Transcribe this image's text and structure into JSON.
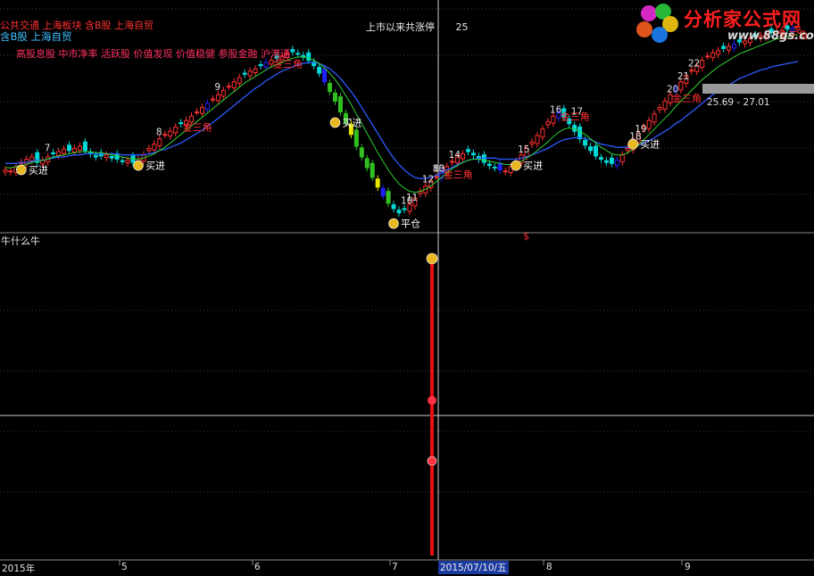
{
  "header": {
    "concept_line1": "公共交通 上海板块 含B股 上海自贸",
    "concept_line2": "含B股 上海自贸",
    "tags_line": "高股息股 中市净率 活跃股 价值发现 价值稳健 参股金融 沪港通",
    "since_listing_label": "上市以来共涨停",
    "since_listing_count": "25",
    "price_range": "25.69 - 27.01"
  },
  "logo": {
    "name": "分析家公式网",
    "url": "www.88gs.com"
  },
  "sub_panel": {
    "title": "牛什么牛"
  },
  "x_axis": {
    "labels": [
      "2015年",
      "5",
      "6",
      "7",
      "8",
      "9"
    ],
    "crosshair_date": "2015/07/10/五"
  },
  "colors": {
    "background": "#000000",
    "up": "#ff3030",
    "down": "#00d8d8",
    "blue_candle": "#2020ff",
    "green_candle": "#30c020",
    "yellow_candle": "#e8e800",
    "ma_slow": "#2a5cff",
    "ma_fast": "#30d030",
    "annotation": "#ff3030",
    "buy_text": "#ffffff"
  },
  "chart_data": {
    "type": "candlestick",
    "title": "",
    "index": [
      0,
      1,
      2,
      3,
      4,
      5,
      6,
      7,
      8,
      9,
      10,
      11,
      12,
      13,
      14,
      15,
      16,
      17,
      18,
      19,
      20,
      21,
      22,
      23,
      24,
      25,
      26,
      27,
      28,
      29,
      30,
      31,
      32,
      33,
      34,
      35,
      36,
      37,
      38,
      39,
      40,
      41,
      42,
      43,
      44,
      45,
      46,
      47,
      48,
      49,
      50,
      51,
      52,
      53,
      54,
      55,
      56,
      57,
      58,
      59,
      60,
      61,
      62,
      63,
      64,
      65,
      66,
      67,
      68,
      69,
      70,
      71,
      72,
      73,
      74,
      75,
      76,
      77,
      78,
      79,
      80,
      81,
      82,
      83,
      84,
      85,
      86,
      87,
      88,
      89,
      90,
      91,
      92,
      93,
      94,
      95,
      96,
      97,
      98,
      99,
      100,
      101,
      102,
      103,
      104,
      105,
      106,
      107,
      108,
      109,
      110,
      111,
      112,
      113,
      114,
      115,
      116,
      117,
      118,
      119,
      120,
      121,
      122,
      123,
      124,
      125,
      126,
      127,
      128,
      129,
      130,
      131,
      132,
      133,
      134,
      135,
      136,
      137,
      138,
      139,
      140,
      141,
      142,
      143,
      144,
      145,
      146,
      147,
      148,
      149
    ],
    "close": [
      28.6,
      28.5,
      28.9,
      29.3,
      29.6,
      29.8,
      29.3,
      29.5,
      29.8,
      30.1,
      30.3,
      30.5,
      30.4,
      30.6,
      30.8,
      30.4,
      30.1,
      29.8,
      29.9,
      30.0,
      29.7,
      29.6,
      29.4,
      29.5,
      29.3,
      29.6,
      30.0,
      30.6,
      31.0,
      31.5,
      31.9,
      32.2,
      32.6,
      32.9,
      33.2,
      33.6,
      34.0,
      34.4,
      34.8,
      35.2,
      35.6,
      36.0,
      36.4,
      36.8,
      37.2,
      37.5,
      37.8,
      38.0,
      38.3,
      38.6,
      38.8,
      39.0,
      39.2,
      39.4,
      39.6,
      39.4,
      39.1,
      38.8,
      38.3,
      37.6,
      36.8,
      35.9,
      35.0,
      34.0,
      33.0,
      31.9,
      30.8,
      29.8,
      28.8,
      27.9,
      27.0,
      26.2,
      25.5,
      25.0,
      24.6,
      24.9,
      25.4,
      26.0,
      26.6,
      27.1,
      27.6,
      28.0,
      28.5,
      28.9,
      29.4,
      29.8,
      30.1,
      30.3,
      30.0,
      29.6,
      29.3,
      29.0,
      28.8,
      28.6,
      28.5,
      28.9,
      29.4,
      30.0,
      30.6,
      31.2,
      31.8,
      32.4,
      33.1,
      33.6,
      33.9,
      33.5,
      32.9,
      32.2,
      31.5,
      30.9,
      30.4,
      29.9,
      29.6,
      29.3,
      29.2,
      29.5,
      30.0,
      30.6,
      31.3,
      32.0,
      32.6,
      33.2,
      33.8,
      34.4,
      35.0,
      35.6,
      36.2,
      36.8,
      37.4,
      37.9,
      38.3,
      38.8,
      39.2,
      39.5,
      39.7,
      39.9,
      40.1,
      40.3,
      40.5,
      40.6,
      40.8,
      41.0,
      41.1,
      41.3,
      41.4,
      41.5,
      41.6,
      41.7,
      41.8,
      41.9
    ],
    "ma_fast": [
      28.8,
      28.8,
      28.9,
      29.0,
      29.1,
      29.3,
      29.4,
      29.5,
      29.6,
      29.8,
      29.9,
      30.0,
      30.1,
      30.2,
      30.3,
      30.3,
      30.3,
      30.2,
      30.2,
      30.1,
      30.0,
      29.9,
      29.8,
      29.7,
      29.6,
      29.6,
      29.7,
      29.9,
      30.1,
      30.4,
      30.7,
      31.1,
      31.5,
      31.9,
      32.3,
      32.7,
      33.1,
      33.5,
      33.9,
      34.3,
      34.7,
      35.1,
      35.5,
      35.9,
      36.3,
      36.7,
      37.0,
      37.3,
      37.6,
      37.9,
      38.2,
      38.4,
      38.6,
      38.8,
      39.0,
      39.1,
      39.1,
      39.0,
      38.8,
      38.5,
      38.1,
      37.6,
      37.0,
      36.3,
      35.5,
      34.7,
      33.8,
      32.9,
      32.0,
      31.1,
      30.2,
      29.4,
      28.6,
      27.9,
      27.3,
      26.9,
      26.6,
      26.5,
      26.6,
      26.8,
      27.1,
      27.5,
      27.9,
      28.3,
      28.7,
      29.0,
      29.3,
      29.5,
      29.6,
      29.6,
      29.5,
      29.4,
      29.3,
      29.2,
      29.1,
      29.1,
      29.2,
      29.4,
      29.7,
      30.0,
      30.4,
      30.8,
      31.2,
      31.7,
      32.1,
      32.4,
      32.5,
      32.4,
      32.2,
      31.9,
      31.5,
      31.1,
      30.7,
      30.4,
      30.1,
      30.0,
      30.0,
      30.2,
      30.5,
      30.9,
      31.4,
      31.9,
      32.4,
      32.9,
      33.4,
      33.9,
      34.5,
      35.0,
      35.5,
      36.0,
      36.5,
      37.0,
      37.4,
      37.8,
      38.2,
      38.5,
      38.8,
      39.1,
      39.4,
      39.6,
      39.8,
      40.0,
      40.2,
      40.4,
      40.6,
      40.8,
      40.9,
      41.0,
      41.1,
      41.2
    ],
    "ma_slow": [
      29.2,
      29.2,
      29.2,
      29.3,
      29.3,
      29.4,
      29.5,
      29.5,
      29.6,
      29.7,
      29.8,
      29.8,
      29.9,
      30.0,
      30.0,
      30.1,
      30.1,
      30.1,
      30.1,
      30.1,
      30.1,
      30.1,
      30.0,
      30.0,
      30.0,
      30.0,
      30.0,
      30.1,
      30.2,
      30.4,
      30.5,
      30.7,
      30.9,
      31.1,
      31.4,
      31.7,
      32.0,
      32.3,
      32.7,
      33.0,
      33.4,
      33.8,
      34.2,
      34.6,
      35.0,
      35.4,
      35.8,
      36.2,
      36.5,
      36.9,
      37.2,
      37.5,
      37.8,
      38.0,
      38.2,
      38.4,
      38.5,
      38.6,
      38.6,
      38.5,
      38.3,
      38.0,
      37.6,
      37.1,
      36.5,
      35.9,
      35.2,
      34.4,
      33.6,
      32.8,
      32.0,
      31.2,
      30.4,
      29.7,
      29.1,
      28.6,
      28.2,
      27.9,
      27.8,
      27.8,
      27.9,
      28.1,
      28.3,
      28.6,
      28.8,
      29.1,
      29.3,
      29.5,
      29.6,
      29.7,
      29.7,
      29.7,
      29.7,
      29.6,
      29.6,
      29.6,
      29.6,
      29.7,
      29.8,
      30.0,
      30.2,
      30.4,
      30.6,
      30.9,
      31.2,
      31.4,
      31.5,
      31.6,
      31.6,
      31.5,
      31.4,
      31.2,
      31.0,
      30.9,
      30.8,
      30.7,
      30.7,
      30.7,
      30.8,
      30.9,
      31.1,
      31.3,
      31.6,
      31.9,
      32.2,
      32.5,
      32.9,
      33.2,
      33.6,
      34.0,
      34.4,
      34.8,
      35.2,
      35.6,
      35.9,
      36.2,
      36.5,
      36.8,
      37.1,
      37.3,
      37.5,
      37.7,
      37.9,
      38.0,
      38.2,
      38.3,
      38.4,
      38.5,
      38.6,
      38.7
    ],
    "ylim": [
      23.0,
      44.0
    ],
    "annotations": [
      {
        "text": "买进",
        "index": 4
      },
      {
        "text": "买进",
        "index": 26
      },
      {
        "text": "买进",
        "index": 63
      },
      {
        "text": "买进",
        "index": 97
      },
      {
        "text": "买进",
        "index": 119
      },
      {
        "text": "金三角",
        "index": 33
      },
      {
        "text": "金三角",
        "index": 50
      },
      {
        "text": "金三角",
        "index": 82
      },
      {
        "text": "金三角",
        "index": 104
      },
      {
        "text": "金三角",
        "index": 125
      },
      {
        "text": "金三角",
        "index": 145
      },
      {
        "text": "平仓",
        "index": 74
      },
      {
        "text": "8",
        "index": 28
      },
      {
        "text": "9",
        "index": 39
      },
      {
        "text": "7",
        "index": 7
      },
      {
        "text": "10",
        "index": 74
      },
      {
        "text": "11",
        "index": 75
      },
      {
        "text": "12",
        "index": 78
      },
      {
        "text": "13",
        "index": 80
      },
      {
        "text": "14",
        "index": 83
      },
      {
        "text": "15",
        "index": 96
      },
      {
        "text": "16",
        "index": 102
      },
      {
        "text": "17",
        "index": 106
      },
      {
        "text": "18",
        "index": 117
      },
      {
        "text": "19",
        "index": 118
      },
      {
        "text": "20",
        "index": 124
      },
      {
        "text": "21",
        "index": 126
      },
      {
        "text": "22",
        "index": 128
      },
      {
        "text": "80",
        "index": 80
      },
      {
        "text": "$",
        "index": 97
      }
    ]
  }
}
